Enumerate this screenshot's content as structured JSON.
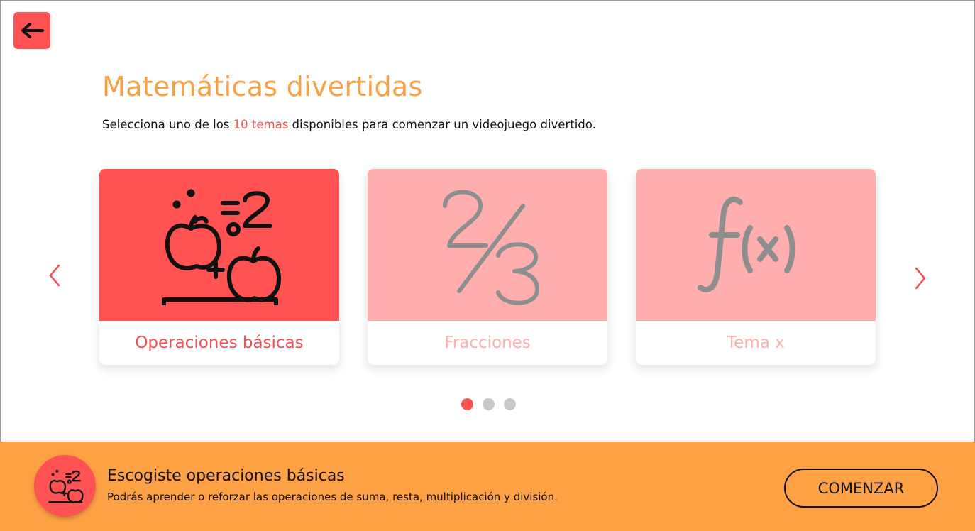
{
  "header": {
    "back_icon": "arrow-left-icon",
    "title": "Matemáticas divertidas",
    "subtitle_prefix": "Selecciona uno de los ",
    "subtitle_highlight": "10 temas",
    "subtitle_suffix": " disponibles para comenzar un videojuego divertido."
  },
  "carousel": {
    "prev_icon": "chevron-left-icon",
    "next_icon": "chevron-right-icon",
    "cards": [
      {
        "label": "Operaciones básicas",
        "icon": "apples-addition-icon",
        "selected": true
      },
      {
        "label": "Fracciones",
        "icon": "fraction-two-thirds-icon",
        "selected": false
      },
      {
        "label": "Tema x",
        "icon": "function-fx-icon",
        "selected": false
      }
    ],
    "pages": 3,
    "active_page": 1
  },
  "footer": {
    "title": "Escogiste operaciones básicas",
    "description": "Podrás aprender o reforzar las operaciones de suma, resta, multiplicación y división.",
    "start_button": "COMENZAR",
    "badge_icon": "apples-addition-icon"
  },
  "colors": {
    "accent_red": "#fe5253",
    "accent_pink": "#ffaeae",
    "title_orange": "#f7a044",
    "footer_orange": "#fea044",
    "dot_inactive": "#c8c8c8"
  }
}
